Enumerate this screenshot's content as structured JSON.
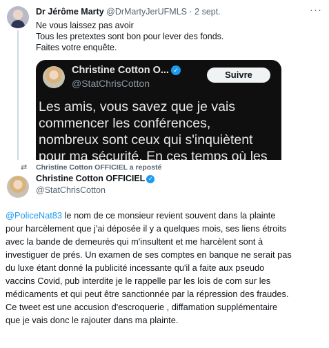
{
  "top_tweet": {
    "author_name": "Dr Jérôme Marty",
    "author_handle": "@DrMartyJerUFMLS",
    "separator": "·",
    "date": "2 sept.",
    "more": "···",
    "text_lines": [
      "Ne vous laissez pas avoir",
      "Tous les pretextes sont bon pour lever des fonds.",
      "Faites votre enquête."
    ],
    "embedded_image": {
      "name": "Christine Cotton O...",
      "handle": "@StatChrisCotton",
      "follow_label": "Suivre",
      "verified_glyph": "✓",
      "text_lines": [
        "Les amis, vous savez que je vais",
        "commencer les conférences,",
        "nombreux sont ceux qui s'inquiètent",
        "pour ma sécurité. En ces temps où les"
      ]
    }
  },
  "bottom_tweet": {
    "repost_icon": "⇄",
    "repost_label": "Christine Cotton OFFICIEL a reposté",
    "author_name": "Christine Cotton OFFICIEL",
    "verified_glyph": "✓",
    "author_handle": "@StatChrisCotton",
    "mention": "@PoliceNat83",
    "first_line_rest": " le nom de ce monsieur revient souvent dans la plainte",
    "text_lines": [
      "pour harcèlement que j'ai déposée il y a quelques mois, ses liens étroits",
      "avec la bande de demeurés qui m'insultent et me harcèlent sont à",
      "investiguer de prés. Un examen de ses comptes en banque ne serait pas",
      "du luxe étant donné la publicité incessante qu'il a faite aux pseudo",
      "vaccins Covid, pub interdite je le rappelle par les lois de com sur les",
      "médicaments et qui peut être sanctionnée par la répression des fraudes.",
      "Ce tweet est une accusion d'escroquerie , diffamation supplémentaire",
      "que je vais donc le rajouter dans ma plainte."
    ]
  },
  "colors": {
    "link": "#1d9bf0",
    "verified": "#1d9bf0",
    "secondary_text": "#536471",
    "dark_card_bg": "#0f0f10"
  }
}
